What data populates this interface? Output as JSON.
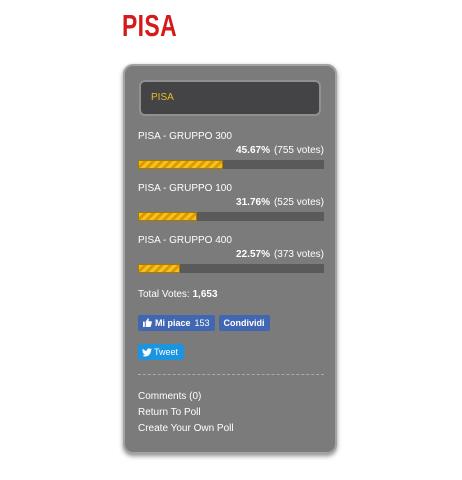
{
  "page": {
    "title": "PISA"
  },
  "poll": {
    "question": "PISA",
    "answers": [
      {
        "label": "PISA - GRUPPO 300",
        "percent": "45.67%",
        "votes": "(755 votes)",
        "fraction": 0.4567
      },
      {
        "label": "PISA - GRUPPO 100",
        "percent": "31.76%",
        "votes": "(525 votes)",
        "fraction": 0.3176
      },
      {
        "label": "PISA - GRUPPO 400",
        "percent": "22.57%",
        "votes": "(373 votes)",
        "fraction": 0.2257
      }
    ],
    "total_label": "Total Votes:",
    "total_value": "1,653",
    "facebook": {
      "like_label": "Mi piace",
      "like_count": "153",
      "share_label": "Condividi"
    },
    "tweet_label": "Tweet",
    "links": {
      "comments": "Comments (0)",
      "return": "Return To Poll",
      "create": "Create Your Own Poll"
    },
    "colors": {
      "accent": "#e6bd25",
      "title": "#d41a1a",
      "card": "#7b7b7b",
      "bar": "#f4c21a"
    }
  }
}
